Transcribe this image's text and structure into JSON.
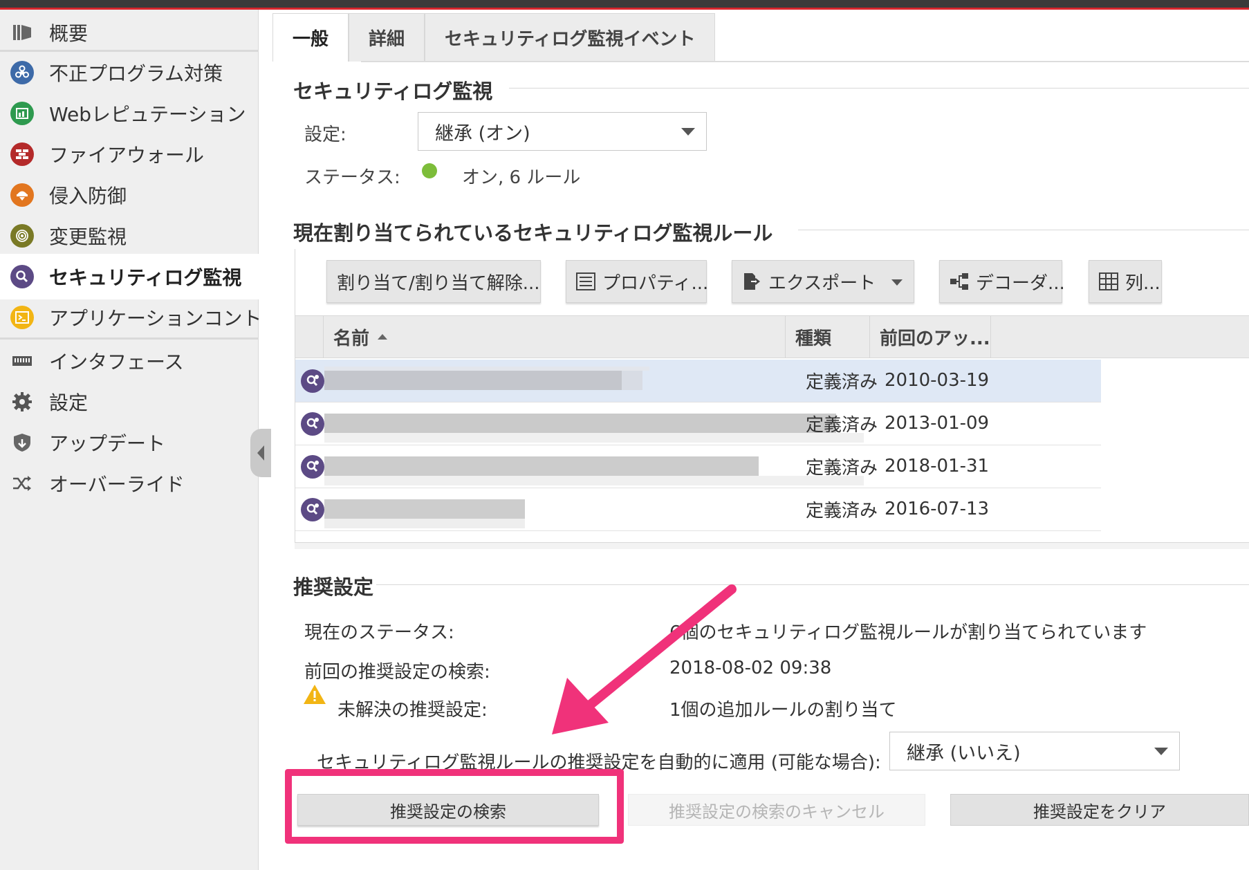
{
  "sidebar": {
    "items": [
      {
        "label": "概要",
        "icon": "dashboard-icon"
      },
      {
        "label": "不正プログラム対策",
        "icon": "biohazard-icon"
      },
      {
        "label": "Webレピュテーション",
        "icon": "web-reputation-icon"
      },
      {
        "label": "ファイアウォール",
        "icon": "firewall-icon"
      },
      {
        "label": "侵入防御",
        "icon": "intrusion-prevention-icon"
      },
      {
        "label": "変更監視",
        "icon": "fingerprint-icon"
      },
      {
        "label": "セキュリティログ監視",
        "icon": "magnifier-icon"
      },
      {
        "label": "アプリケーションコント",
        "icon": "terminal-icon"
      },
      {
        "label": "インタフェース",
        "icon": "interface-icon"
      },
      {
        "label": "設定",
        "icon": "gear-icon"
      },
      {
        "label": "アップデート",
        "icon": "update-shield-icon"
      },
      {
        "label": "オーバーライド",
        "icon": "shuffle-icon"
      }
    ]
  },
  "tabs": [
    "一般",
    "詳細",
    "セキュリティログ監視イベント"
  ],
  "section_log": {
    "title": "セキュリティログ監視",
    "setting_label": "設定:",
    "setting_value": "継承 (オン)",
    "status_label": "ステータス:",
    "status_value": "オン, 6 ルール",
    "status_color": "#7dbd3a"
  },
  "section_rules": {
    "title": "現在割り当てられているセキュリティログ監視ルール",
    "toolbar": {
      "assign": "割り当て/割り当て解除...",
      "properties": "プロパティ...",
      "export": "エクスポート",
      "decoders": "デコーダ...",
      "columns": "列..."
    },
    "columns": {
      "name": "名前",
      "type": "種類",
      "last_update": "前回のアッ..."
    },
    "rows": [
      {
        "type": "定義済み",
        "date": "2010-03-19"
      },
      {
        "type": "定義済み",
        "date": "2013-01-09"
      },
      {
        "type": "定義済み",
        "date": "2018-01-31"
      },
      {
        "type": "定義済み",
        "date": "2016-07-13"
      }
    ]
  },
  "section_rec": {
    "title": "推奨設定",
    "current_status_label": "現在のステータス:",
    "current_status_value": "6個のセキュリティログ監視ルールが割り当てられています",
    "last_scan_label": "前回の推奨設定の検索:",
    "last_scan_value": "2018-08-02 09:38",
    "unresolved_label": "未解決の推奨設定:",
    "unresolved_value": "1個の追加ルールの割り当て",
    "auto_apply_label": "セキュリティログ監視ルールの推奨設定を自動的に適用 (可能な場合):",
    "auto_apply_value": "継承 (いいえ)",
    "scan_button": "推奨設定の検索",
    "cancel_button": "推奨設定の検索のキャンセル",
    "clear_button": "推奨設定をクリア"
  },
  "colors": {
    "accent_red": "#d6262d",
    "annotation_pink": "#f0327a",
    "rule_icon": "#5c4a85"
  }
}
